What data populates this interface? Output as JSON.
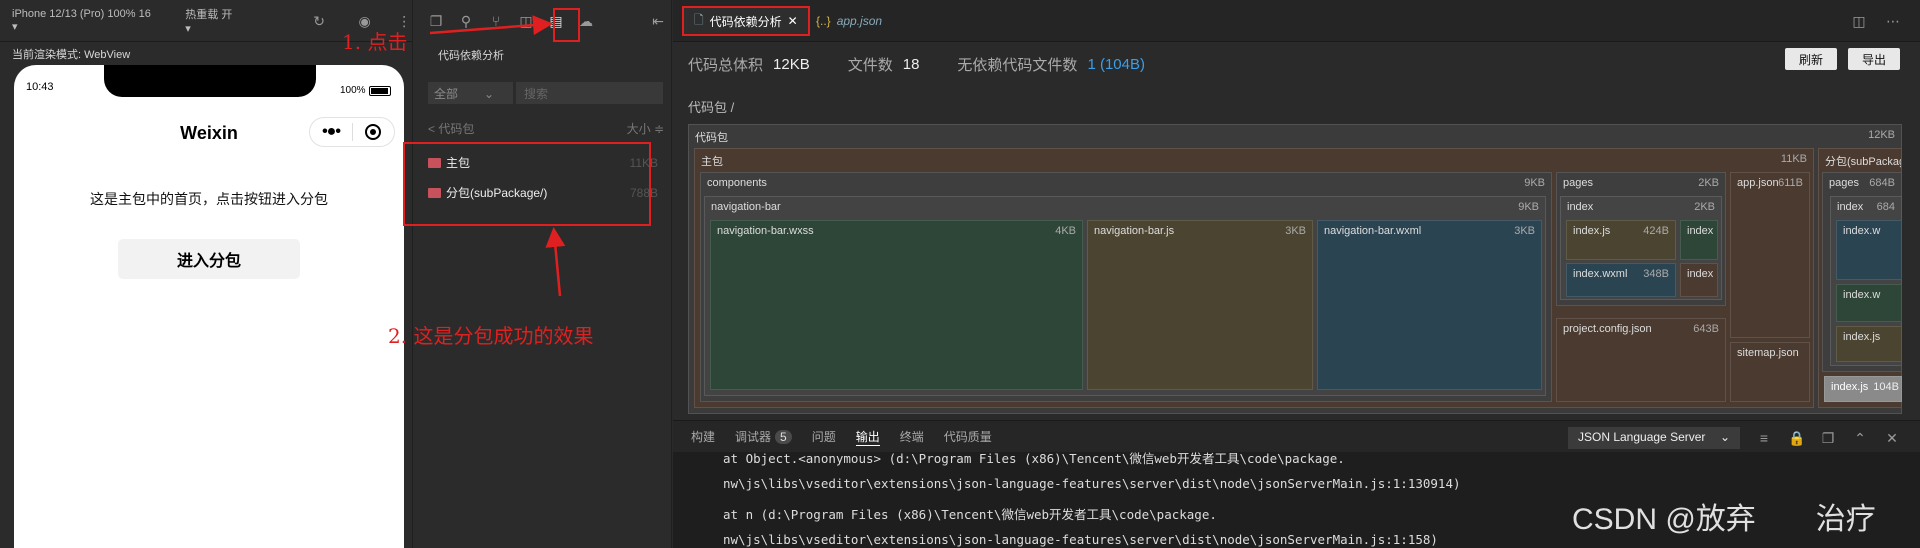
{
  "simulator": {
    "device": "iPhone 12/13 (Pro) 100% 16 ▾",
    "hot_reload": "热重载 开 ▾",
    "render_mode": "当前渲染模式: WebView",
    "time": "10:43",
    "battery": "100%",
    "nav_title": "Weixin",
    "page_text": "这是主包中的首页，点击按钮进入分包",
    "enter_button": "进入分包"
  },
  "analysis_panel": {
    "title": "代码依赖分析",
    "filter": "全部",
    "search_placeholder": "搜索",
    "tree_header": "< 代码包",
    "sort_label": "大小 ≑",
    "items": [
      {
        "name": "主包",
        "size": "11KB"
      },
      {
        "name": "分包(subPackage/)",
        "size": "788B"
      }
    ]
  },
  "tabs": [
    {
      "label": "代码依赖分析",
      "close": "✕"
    },
    {
      "label": "app.json",
      "icon": "{..}"
    }
  ],
  "summary": {
    "total_label": "代码总体积",
    "total_value": "12KB",
    "files_label": "文件数",
    "files_value": "18",
    "unused_label": "无依赖代码文件数",
    "unused_value": "1 (104B)",
    "refresh": "刷新",
    "export": "导出"
  },
  "breadcrumb": "代码包 /",
  "treemap": {
    "root": {
      "label": "代码包",
      "size": "12KB"
    },
    "main": {
      "label": "主包",
      "size": "11KB"
    },
    "sub": {
      "label": "分包(subPackage)"
    },
    "components": {
      "label": "components",
      "size": "9KB"
    },
    "navbar": {
      "label": "navigation-bar",
      "size": "9KB"
    },
    "wxss": {
      "label": "navigation-bar.wxss",
      "size": "4KB"
    },
    "js": {
      "label": "navigation-bar.js",
      "size": "3KB"
    },
    "wxml": {
      "label": "navigation-bar.wxml",
      "size": "3KB"
    },
    "pages": {
      "label": "pages",
      "size": "2KB"
    },
    "index": {
      "label": "index",
      "size": "2KB"
    },
    "index_js": {
      "label": "index.js",
      "size": "424B"
    },
    "index_wxml": {
      "label": "index.wxml",
      "size": "348B"
    },
    "index_a": "index",
    "index_b": "index",
    "app_json": {
      "label": "app.json",
      "size": "611B"
    },
    "project_config": {
      "label": "project.config.json",
      "size": "643B"
    },
    "sitemap": {
      "label": "sitemap.json"
    },
    "sub_pages": {
      "label": "pages",
      "size": "684B"
    },
    "sub_index": {
      "label": "index",
      "size": "684"
    },
    "sub_w1": "index.w",
    "sub_w2": "index.w",
    "sub_j": "index.js",
    "sub_unused": {
      "label": "index.js",
      "size": "104B"
    }
  },
  "bottom_tabs": [
    {
      "label": "构建"
    },
    {
      "label": "调试器",
      "badge": "5"
    },
    {
      "label": "问题"
    },
    {
      "label": "输出"
    },
    {
      "label": "终端"
    },
    {
      "label": "代码质量"
    }
  ],
  "language_server": "JSON Language Server",
  "console_lines": [
    "at Object.<anonymous> (d:\\Program Files (x86)\\Tencent\\微信web开发者工具\\code\\package.",
    "nw\\js\\libs\\vseditor\\extensions\\json-language-features\\server\\dist\\node\\jsonServerMain.js:1:130914)",
    "at n (d:\\Program Files (x86)\\Tencent\\微信web开发者工具\\code\\package.",
    "nw\\js\\libs\\vseditor\\extensions\\json-language-features\\server\\dist\\node\\jsonServerMain.js:1:158)"
  ],
  "annotations": {
    "step1": "1. 点击",
    "step2": "2. 这是分包成功的效果"
  },
  "watermark": "CSDN @放弃　　治疗",
  "colors": {
    "annotation": "#e02020",
    "link": "#3b9ee8"
  }
}
